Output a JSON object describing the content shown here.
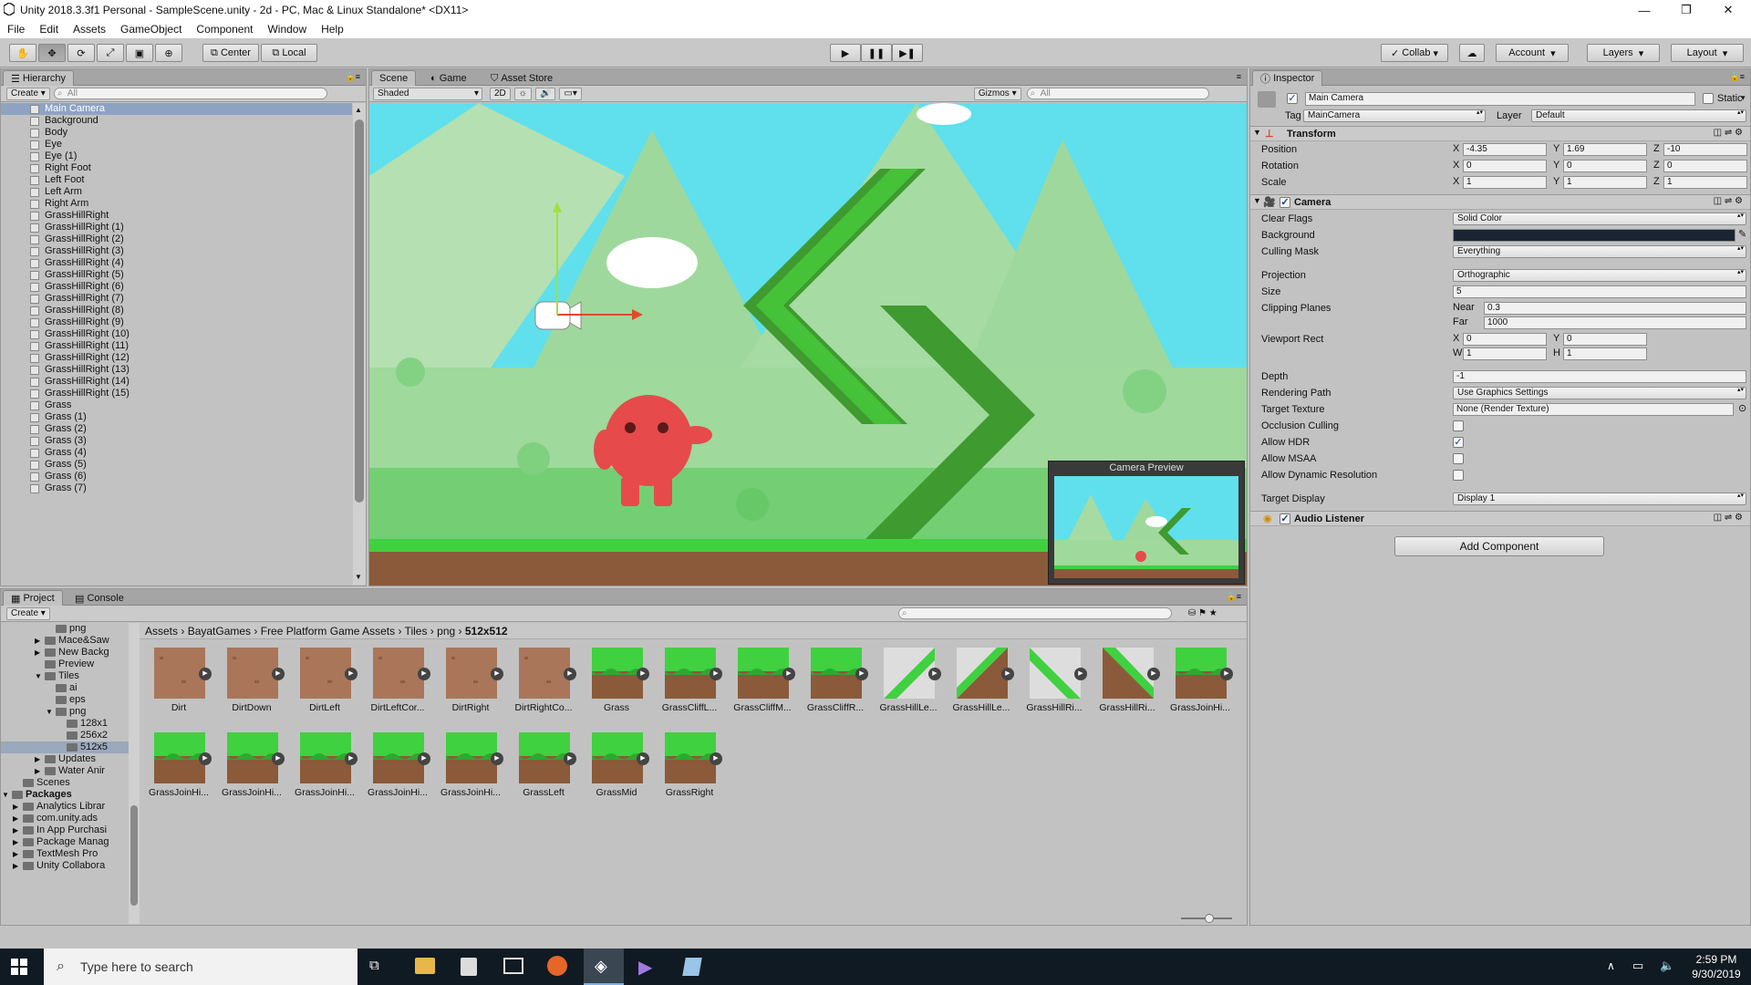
{
  "window": {
    "title": "Unity 2018.3.3f1 Personal - SampleScene.unity - 2d - PC, Mac & Linux Standalone* <DX11>",
    "minimize": "—",
    "maximize": "❐",
    "close": "✕"
  },
  "menu": [
    "File",
    "Edit",
    "Assets",
    "GameObject",
    "Component",
    "Window",
    "Help"
  ],
  "toolbar": {
    "center": "Center",
    "local": "Local",
    "collab": "Collab",
    "account": "Account",
    "layers": "Layers",
    "layout": "Layout"
  },
  "hierarchy": {
    "tab": "Hierarchy",
    "create": "Create",
    "search": "All",
    "items": [
      "Main Camera",
      "Background",
      "Body",
      "Eye",
      "Eye (1)",
      "Right Foot",
      "Left Foot",
      "Left Arm",
      "Right Arm",
      "GrassHillRight",
      "GrassHillRight (1)",
      "GrassHillRight (2)",
      "GrassHillRight (3)",
      "GrassHillRight (4)",
      "GrassHillRight (5)",
      "GrassHillRight (6)",
      "GrassHillRight (7)",
      "GrassHillRight (8)",
      "GrassHillRight (9)",
      "GrassHillRight (10)",
      "GrassHillRight (11)",
      "GrassHillRight (12)",
      "GrassHillRight (13)",
      "GrassHillRight (14)",
      "GrassHillRight (15)",
      "Grass",
      "Grass (1)",
      "Grass (2)",
      "Grass (3)",
      "Grass (4)",
      "Grass (5)",
      "Grass (6)",
      "Grass (7)"
    ]
  },
  "scene": {
    "tabs": [
      "Scene",
      "Game",
      "Asset Store"
    ],
    "shading": "Shaded",
    "mode2d": "2D",
    "gizmos": "Gizmos",
    "search": "All",
    "preview_title": "Camera Preview"
  },
  "inspector": {
    "tab": "Inspector",
    "object_name": "Main Camera",
    "static_label": "Static",
    "tag_label": "Tag",
    "tag": "MainCamera",
    "layer_label": "Layer",
    "layer": "Default",
    "transform": {
      "title": "Transform",
      "position_label": "Position",
      "rotation_label": "Rotation",
      "scale_label": "Scale",
      "position": [
        "-4.35",
        "1.69",
        "-10"
      ],
      "rotation": [
        "0",
        "0",
        "0"
      ],
      "scale": [
        "1",
        "1",
        "1"
      ]
    },
    "axes": [
      "X",
      "Y",
      "Z"
    ],
    "camera": {
      "title": "Camera",
      "clear_flags_label": "Clear Flags",
      "clear_flags": "Solid Color",
      "background_label": "Background",
      "background_color": "#1a2433",
      "culling_mask_label": "Culling Mask",
      "culling_mask": "Everything",
      "projection_label": "Projection",
      "projection": "Orthographic",
      "size_label": "Size",
      "size": "5",
      "clipping_label": "Clipping Planes",
      "near_label": "Near",
      "near": "0.3",
      "far_label": "Far",
      "far": "1000",
      "viewport_label": "Viewport Rect",
      "vx_label": "X",
      "vx": "0",
      "vy_label": "Y",
      "vy": "0",
      "vw_label": "W",
      "vw": "1",
      "vh_label": "H",
      "vh": "1",
      "depth_label": "Depth",
      "depth": "-1",
      "rendering_path_label": "Rendering Path",
      "rendering_path": "Use Graphics Settings",
      "target_texture_label": "Target Texture",
      "target_texture": "None (Render Texture)",
      "occlusion_label": "Occlusion Culling",
      "hdr_label": "Allow HDR",
      "msaa_label": "Allow MSAA",
      "dynres_label": "Allow Dynamic Resolution",
      "target_display_label": "Target Display",
      "target_display": "Display 1",
      "occlusion": false,
      "hdr": true,
      "msaa": false,
      "dynres": false
    },
    "audio_listener": "Audio Listener",
    "add_component": "Add Component"
  },
  "project": {
    "tabs": [
      "Project",
      "Console"
    ],
    "create": "Create",
    "breadcrumb": [
      "Assets",
      "BayatGames",
      "Free Platform Game Assets",
      "Tiles",
      "png",
      "512x512"
    ],
    "tree": [
      {
        "label": "png",
        "indent": 60
      },
      {
        "label": "Mace&Saw",
        "indent": 48,
        "arrow": "▶"
      },
      {
        "label": "New Backg",
        "indent": 48,
        "arrow": "▶"
      },
      {
        "label": "Preview",
        "indent": 48
      },
      {
        "label": "Tiles",
        "indent": 48,
        "arrow": "▼"
      },
      {
        "label": "ai",
        "indent": 60
      },
      {
        "label": "eps",
        "indent": 60
      },
      {
        "label": "png",
        "indent": 60,
        "arrow": "▼"
      },
      {
        "label": "128x1",
        "indent": 72
      },
      {
        "label": "256x2",
        "indent": 72
      },
      {
        "label": "512x5",
        "indent": 72,
        "selected": true
      },
      {
        "label": "Updates",
        "indent": 48,
        "arrow": "▶"
      },
      {
        "label": "Water Anir",
        "indent": 48,
        "arrow": "▶"
      },
      {
        "label": "Scenes",
        "indent": 24
      },
      {
        "label": "Packages",
        "indent": 12,
        "arrow": "▼",
        "bold": true
      },
      {
        "label": "Analytics Librar",
        "indent": 24,
        "arrow": "▶"
      },
      {
        "label": "com.unity.ads",
        "indent": 24,
        "arrow": "▶"
      },
      {
        "label": "In App Purchasi",
        "indent": 24,
        "arrow": "▶"
      },
      {
        "label": "Package Manag",
        "indent": 24,
        "arrow": "▶"
      },
      {
        "label": "TextMesh Pro",
        "indent": 24,
        "arrow": "▶"
      },
      {
        "label": "Unity Collabora",
        "indent": 24,
        "arrow": "▶"
      }
    ],
    "assets": [
      {
        "name": "Dirt",
        "kind": "dirt"
      },
      {
        "name": "DirtDown",
        "kind": "dirt"
      },
      {
        "name": "DirtLeft",
        "kind": "dirt"
      },
      {
        "name": "DirtLeftCor...",
        "kind": "dirt"
      },
      {
        "name": "DirtRight",
        "kind": "dirt"
      },
      {
        "name": "DirtRightCo...",
        "kind": "dirt"
      },
      {
        "name": "Grass",
        "kind": "grass"
      },
      {
        "name": "GrassCliffL...",
        "kind": "grass"
      },
      {
        "name": "GrassCliffM...",
        "kind": "grass"
      },
      {
        "name": "GrassCliffR...",
        "kind": "grass"
      },
      {
        "name": "GrassHillLe...",
        "kind": "hill1"
      },
      {
        "name": "GrassHillLe...",
        "kind": "hill2"
      },
      {
        "name": "GrassHillRi...",
        "kind": "hill3"
      },
      {
        "name": "GrassHillRi...",
        "kind": "hill4"
      },
      {
        "name": "GrassJoinHi...",
        "kind": "grass"
      },
      {
        "name": "GrassJoinHi...",
        "kind": "grass"
      },
      {
        "name": "GrassJoinHi...",
        "kind": "grass"
      },
      {
        "name": "GrassJoinHi...",
        "kind": "grass"
      },
      {
        "name": "GrassJoinHi...",
        "kind": "grass"
      },
      {
        "name": "GrassJoinHi...",
        "kind": "grass"
      },
      {
        "name": "GrassLeft",
        "kind": "grass"
      },
      {
        "name": "GrassMid",
        "kind": "grass"
      },
      {
        "name": "GrassRight",
        "kind": "grass"
      }
    ]
  },
  "taskbar": {
    "search": "Type here to search",
    "time": "2:59 PM",
    "date": "9/30/2019"
  }
}
